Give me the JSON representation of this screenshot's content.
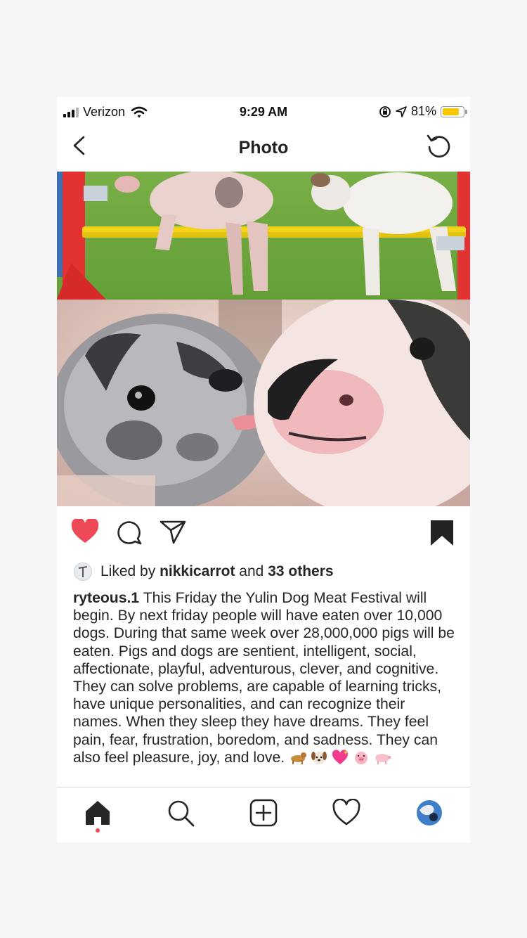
{
  "status": {
    "carrier": "Verizon",
    "time": "9:29 AM",
    "battery": "81%",
    "battery_level": 0.81
  },
  "header": {
    "title": "Photo"
  },
  "post": {
    "liked_prefix": "Liked by",
    "liked_user": "nikkicarrot",
    "liked_middle": "and",
    "liked_others": "33 others",
    "username": "ryteous.1",
    "caption": "This Friday the Yulin Dog Meat Festival will begin. By next friday people will have eaten over 10,000 dogs. During that same week over 28,000,000 pigs will be eaten. Pigs and dogs are sentient, intelligent, social, affectionate, playful, adventurous, clever, and cognitive. They can solve problems, are capable of learning tricks, have unique personalities, and can recognize their names. When they sleep they have dreams. They feel pain, fear, frustration, boredom, and sadness. They can also feel pleasure, joy, and love.",
    "emojis": [
      "dog-emoji",
      "dog-face-emoji",
      "sparkling-heart-emoji",
      "pig-face-emoji",
      "pig-emoji"
    ]
  },
  "icons": {
    "like": "heart-filled-icon",
    "comment": "comment-icon",
    "share": "send-icon",
    "save": "bookmark-filled-icon",
    "home": "home-icon",
    "search": "search-icon",
    "add": "add-post-icon",
    "activity": "heart-outline-icon",
    "profile": "profile-avatar"
  },
  "colors": {
    "like_red": "#ed4956",
    "text": "#262626",
    "battery": "#f7c800"
  }
}
